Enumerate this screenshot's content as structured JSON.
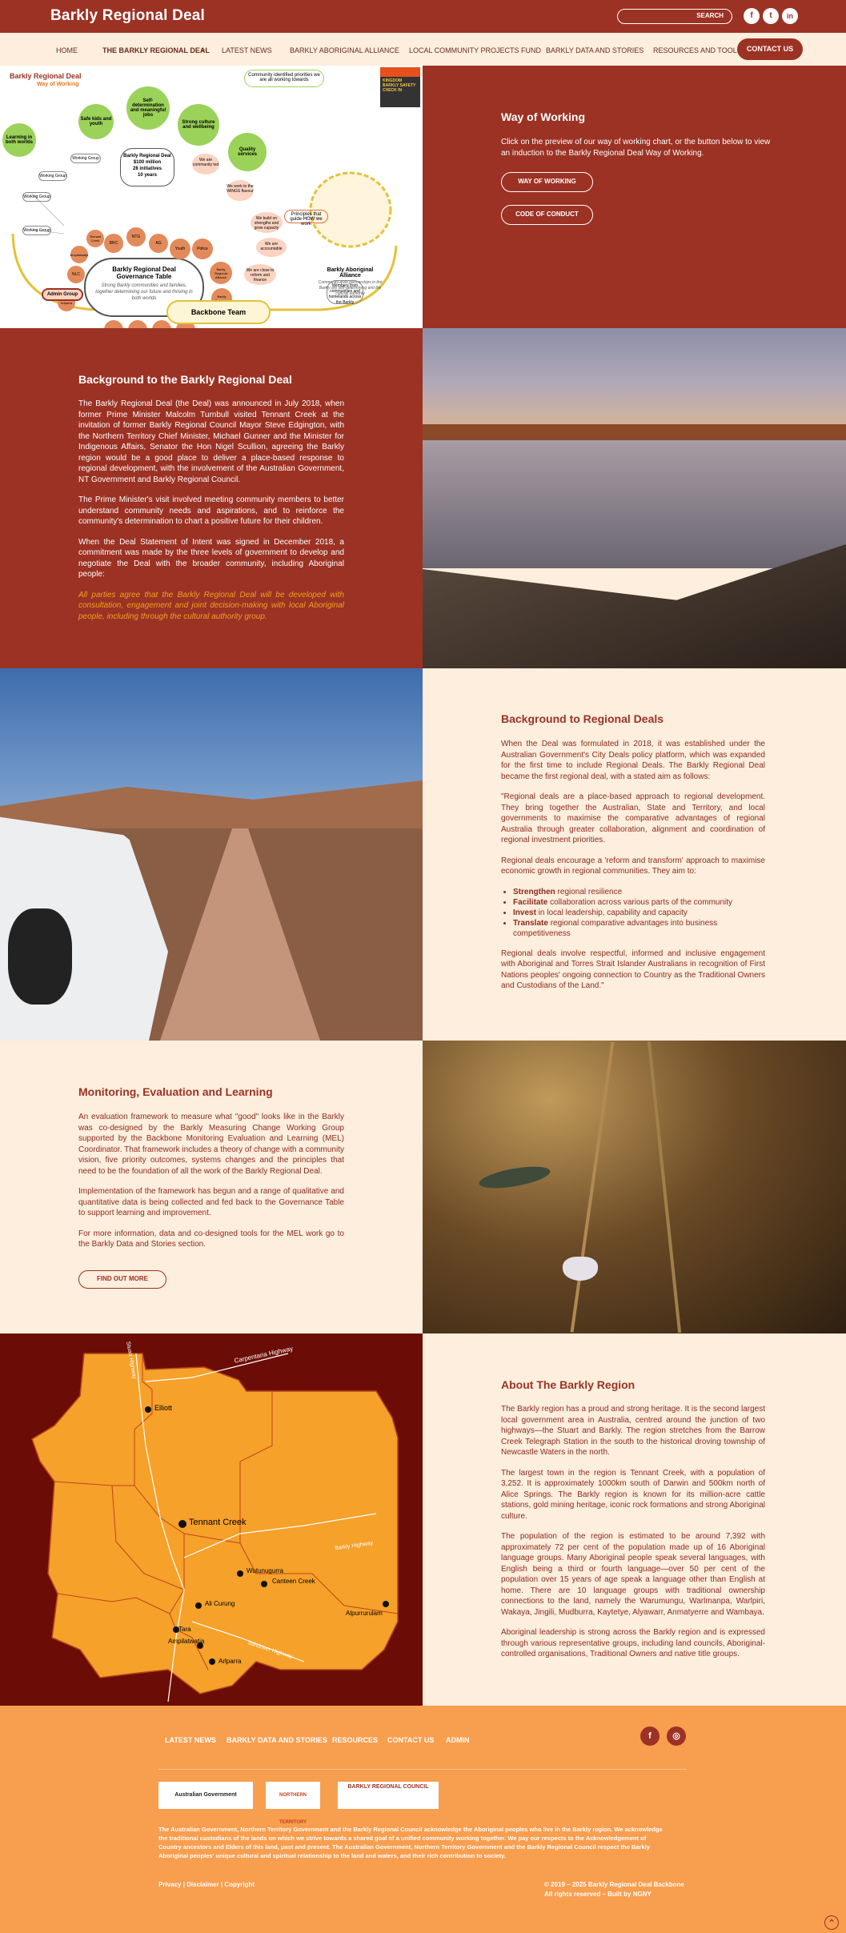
{
  "site": {
    "title": "Barkly Regional Deal",
    "search_label": "SEARCH"
  },
  "social": [
    "f",
    "t",
    "in"
  ],
  "nav": {
    "items": [
      "HOME",
      "THE BARKLY REGIONAL DEAL",
      "LATEST NEWS",
      "BARKLY ABORIGINAL ALLIANCE",
      "LOCAL COMMUNITY PROJECTS FUND",
      "BARKLY DATA AND STORIES",
      "RESOURCES AND TOOLS"
    ],
    "dropdown": "⌄",
    "contact": "CONTACT US"
  },
  "diagram": {
    "title": "Barkly Regional Deal",
    "subtitle": "Way of Working",
    "bubbles": [
      "Learning in both worlds",
      "Safe kids and youth",
      "Self-determination and meaningful jobs",
      "Strong culture and wellbeing",
      "Quality services"
    ],
    "center_box": [
      "Barkly Regional Deal",
      "$100 million",
      "28 initiatives",
      "10 years"
    ],
    "governance_title": "Barkly Regional Deal Governance Table",
    "governance_sub": "Strong Barkly communities and families, together determining our future and thriving in both worlds",
    "alliance_title": "Barkly Aboriginal Alliance",
    "alliance_sub": "Community-level partnerships in the Barkly are self-determining and the cultural authority",
    "priorities_label": "Community identified priorities we are all working towards",
    "principles_label": "Principles that guide HOW we work",
    "working_group": "Working Group",
    "admin_group": "Admin Group",
    "backbone": "Backbone Team",
    "members_label": "Members from communities and homelands across the Barkly",
    "small_labels": [
      "We are community led",
      "We work to the WINGS flavour",
      "We build on strengths and grow capacity",
      "We are accountable",
      "We are close to reform and finance"
    ],
    "petals": [
      "BRC",
      "NTG",
      "AG",
      "Youth",
      "Police",
      "NLC",
      "Barkly Regional Alliance",
      "Barkly Business",
      "Elliott",
      "Ali Curung",
      "Alpurrurulam",
      "Wutunugurra",
      "Arlparra",
      "Ampilatwatja",
      "Tennant Creek"
    ],
    "thumb_text": "KINGDOM BARKLY SAFETY CHECK IN"
  },
  "way": {
    "title": "Way of Working",
    "text": "Click on the preview of our way of working chart, or the button below to view an induction to the Barkly Regional Deal Way of Working.",
    "btn1": "WAY OF WORKING",
    "btn2": "CODE OF CONDUCT"
  },
  "background": {
    "title": "Background to the Barkly Regional Deal",
    "paras": [
      "The Barkly Regional Deal (the Deal) was announced in July 2018, when former Prime Minister Malcolm Turnbull visited Tennant Creek at the invitation of former Barkly Regional Council Mayor Steve Edgington, with the Northern Territory Chief Minister, Michael Gunner and the Minister for Indigenous Affairs, Senator the Hon Nigel Scullion, agreeing the Barkly region would be a good place to deliver a place-based response to regional development, with the involvement of the Australian Government, NT Government and Barkly Regional Council.",
      "The Prime Minister's visit involved meeting community members to better understand community needs and aspirations, and to reinforce the community's determination to chart a positive future for their children.",
      "When the Deal Statement of Intent was signed in December 2018, a commitment was made by the three levels of government to develop and negotiate the Deal with the broader community, including Aboriginal people:"
    ],
    "quote": "All parties agree that the Barkly Regional Deal will be developed with consultation, engagement and joint decision-making with local Aboriginal people, including through the cultural authority group."
  },
  "regional": {
    "title": "Background to Regional Deals",
    "p1": "When the Deal was formulated in 2018, it was established under the Australian Government's City Deals policy platform, which was expanded for the first time to include Regional Deals.  The Barkly Regional Deal became the first regional deal, with a stated aim as follows:",
    "p2": "\"Regional deals are a place-based approach to regional development. They bring together the Australian, State and Territory, and local governments to maximise the comparative advantages of regional Australia through greater collaboration, alignment and coordination of regional investment priorities.",
    "p3": "Regional deals encourage a 'reform and transform' approach to maximise economic growth in regional communities. They aim to:",
    "bullets": [
      {
        "b": "Strengthen",
        "t": " regional resilience"
      },
      {
        "b": "Facilitate",
        "t": " collaboration across various parts of the community"
      },
      {
        "b": "Invest",
        "t": " in local leadership, capability and capacity"
      },
      {
        "b": "Translate",
        "t": " regional comparative advantages into business competitiveness"
      }
    ],
    "p4": "Regional deals involve respectful, informed and inclusive engagement with Aboriginal and Torres Strait Islander Australians in recognition of First Nations peoples' ongoing connection to Country as the Traditional Owners and Custodians of the Land.\""
  },
  "mel": {
    "title": "Monitoring, Evaluation and Learning",
    "paras": [
      "An evaluation framework to measure what \"good\" looks like in the Barkly was co-designed by the Barkly Measuring Change Working Group supported by the Backbone Monitoring Evaluation and Learning (MEL) Coordinator. That framework includes a theory of change with a community vision, five priority outcomes, systems changes and the principles that need to be the foundation of all the work of the Barkly Regional Deal.",
      "Implementation of the framework has begun and a range of qualitative and quantitative data is being collected and fed back to the Governance Table to support learning and improvement.",
      "For more information, data and co-designed tools for the MEL work go to the Barkly Data and Stories section."
    ],
    "btn": "FIND OUT MORE"
  },
  "map": {
    "towns": [
      "Elliott",
      "Tennant Creek",
      "Wutunugurra",
      "Canteen Creek",
      "Ali Curung",
      "Alpurrurulam",
      "Tara",
      "Ampilatwatja",
      "Arlparra"
    ],
    "roads": [
      "Carpentaria Highway",
      "Stuart Highway",
      "Barkly Highway",
      "Sandover Highway"
    ]
  },
  "region": {
    "title": "About The Barkly Region",
    "paras": [
      "The Barkly region has a proud and strong heritage. It is the second largest local government area in Australia, centred around the junction of two highways—the Stuart and Barkly. The region stretches from the Barrow Creek Telegraph Station in the south to the historical droving township of Newcastle Waters in the north.",
      "The largest town in the region is Tennant Creek, with a population of 3,252. It is approximately 1000km south of Darwin and 500km north of Alice Springs. The Barkly region is known for its million-acre cattle stations, gold mining heritage, iconic rock formations and strong Aboriginal culture.",
      "The population of the region is estimated to be around 7,392 with approximately 72 per cent of the population made up of 16 Aboriginal language groups. Many Aboriginal people speak several languages, with English being a third or fourth language—over 50 per cent of the population over 15 years of age speak a language other than English at home. There are 10 language groups with traditional ownership connections to the land, namely the Warumungu, Warlmanpa, Warlpiri, Wakaya, Jingili, Mudburra, Kaytetye, Alyawarr, Anmatyerre and Wambaya.",
      "Aboriginal leadership is strong across the Barkly region and is expressed through various representative groups, including land councils, Aboriginal-controlled organisations, Traditional Owners and native title groups."
    ]
  },
  "footer": {
    "links": [
      "LATEST NEWS",
      "BARKLY DATA AND STORIES",
      "RESOURCES",
      "CONTACT US",
      "ADMIN"
    ],
    "social": [
      "f",
      "◎"
    ],
    "logos": [
      "Australian Government",
      "NORTHERN TERRITORY",
      "BARKLY REGIONAL COUNCIL"
    ],
    "ack": "The Australian Government, Northern Territory Government and the Barkly Regional Council acknowledge the Aboriginal peoples who live in the Barkly region. We acknowledge the traditional custodians of the lands on which we strive towards a shared goal of a unified community working together. We pay our respects to the Acknowledgement of Country ancestors and Elders of this land, past and present. The Australian Government, Northern Territory Government and the Barkly Regional Council respect the Barkly Aboriginal peoples' unique cultural and spiritual relationship to the land and waters, and their rich contribution to society.",
    "legal": "Privacy | Disclaimer | Copyright",
    "copy": "© 2019 – 2025 Barkly Regional Deal Backbone",
    "rights": "All rights reserved – Built by NGNY",
    "top": "⌃"
  },
  "colors": {
    "brand_red": "#9c3224",
    "cream": "#fdeedd",
    "orange": "#f89e4f",
    "map_orange": "#f5a12a",
    "map_bg": "#6b0d06",
    "text_red": "#8c2a1c",
    "quote": "#f0a020"
  }
}
